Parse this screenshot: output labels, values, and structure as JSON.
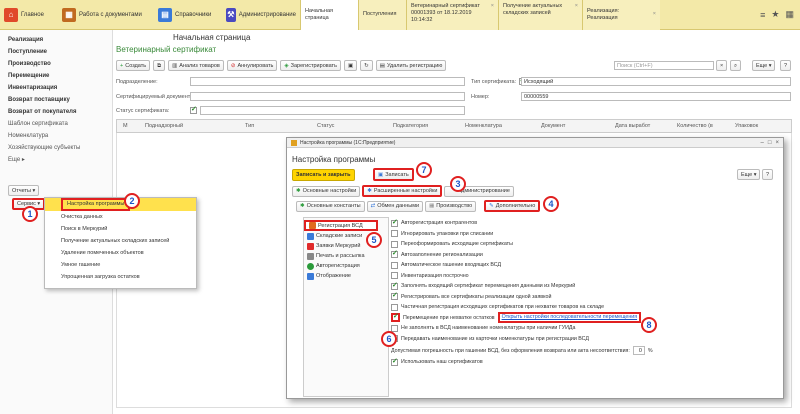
{
  "topbar": {
    "sections": [
      {
        "label": "Главное",
        "icon": "home-icon",
        "color": "#e04a2a"
      },
      {
        "label": "Работа с документами",
        "icon": "briefcase-icon",
        "color": "#c06a20"
      },
      {
        "label": "Справочники",
        "icon": "book-icon",
        "color": "#3a7ad8"
      },
      {
        "label": "Администрирование",
        "icon": "tools-icon",
        "color": "#4a4ac0"
      }
    ],
    "tabs": [
      "Начальная страница",
      "Поступления",
      "Ветеринарный сертификат 00001393 от 18.12.2019 10:14:32",
      "Получение актуальных складских записей",
      "Реализация: Реализация"
    ]
  },
  "leftnav": {
    "items": [
      "Реализация",
      "Поступление",
      "Производство",
      "Перемещение",
      "Инвентаризация",
      "Возврат поставщику",
      "Возврат от покупателя",
      "Шаблон сертификата",
      "Номенклатура",
      "Хозяйствующие субъекты",
      "Еще ▸"
    ],
    "reports": "Отчеты ▾",
    "service": "Сервис ▾"
  },
  "service_menu": [
    "Настройка программы",
    "Очистка данных",
    "Поиск в Меркурий",
    "Получение актуальных складских записей",
    "Удаление помеченных объектов",
    "Умное гашение",
    "Упрощенная загрузка остатков"
  ],
  "main": {
    "page_title": "Начальная страница",
    "doc_title": "Ветеринарный сертификат",
    "toolbar": [
      "Создать",
      "Анализ товаров",
      "Аннулировать",
      "Зарегистрировать",
      "Удалить регистрацию"
    ],
    "search_placeholder": "Поиск (Ctrl+F)",
    "more": "Еще ▾",
    "help": "?",
    "filters": {
      "subdivision": "Подразделение:",
      "certified_doc": "Сертифицируемый документ:",
      "status": "Статус сертификата:",
      "cert_type": "Тип сертификата:",
      "cert_type_value": "Исходящий",
      "number": "Номер:",
      "number_value": "00000559"
    },
    "columns": [
      "М",
      "Поднадзорный",
      "Тип",
      "Статус",
      "Подкатегория",
      "Номенклатура",
      "Документ",
      "Дата выработ",
      "Количество (в",
      "Упаковок"
    ]
  },
  "dialog": {
    "window_title": "Настройка программы (1С:Предприятие)",
    "title": "Настройка программы",
    "save_close": "Записать и закрыть",
    "save": "Записать",
    "more": "Еще ▾",
    "help": "?",
    "tabs1": [
      "Основные настройки",
      "Расширенные настройки",
      "Администрирование"
    ],
    "tabs2": [
      "Основные константы",
      "Обмен данными",
      "Производство",
      "Дополнительно"
    ],
    "sidebar": [
      {
        "label": "Регистрация ВСД",
        "color": "#e06a20"
      },
      {
        "label": "Складские записи",
        "color": "#3a7ad8"
      },
      {
        "label": "Заявки Меркурий",
        "color": "#e02a2a"
      },
      {
        "label": "Печать и рассылка",
        "color": "#888888"
      },
      {
        "label": "Авторегистрация",
        "color": "#2a9a3a"
      },
      {
        "label": "Отображение",
        "color": "#3a7ad8"
      }
    ],
    "options": [
      {
        "label": "Авторегистрация контрагентов",
        "on": true
      },
      {
        "label": "Игнорировать упаковки при списании",
        "on": false
      },
      {
        "label": "Переоформировать исходящие сертификаты",
        "on": false
      },
      {
        "label": "Автозаполнение регионализации",
        "on": true
      },
      {
        "label": "Автоматическое гашение входящих ВСД",
        "on": false
      },
      {
        "label": "Инвентаризация построчно",
        "on": false
      },
      {
        "label": "Заполнять входящий сертификат перемещения данными из Меркурий",
        "on": true
      },
      {
        "label": "Регистрировать все сертификаты реализации одной заявкой",
        "on": true
      },
      {
        "label": "Частичная регистрация исходящих сертификатов при нехватке товаров на складе",
        "on": false
      },
      {
        "label": "Перемещение при нехватке остатков",
        "on": true,
        "link": "Открыть настройки последовательности перемещения"
      },
      {
        "label": "Не заполнять в ВСД наименование номенклатуры при наличии ГУИДа",
        "on": false
      },
      {
        "label": "Передавать наименование из карточки номенклатуры при регистрации ВСД",
        "on": false
      }
    ],
    "tolerance_label": "Допустимая погрешность при гашении ВСД, без оформления возврата или акта несоответствия:",
    "tolerance_value": "0",
    "tolerance_unit": "%",
    "use_our_certs": "Использовать наш сертификатов",
    "use_our_certs_on": true
  },
  "callouts": [
    "1",
    "2",
    "3",
    "4",
    "5",
    "6",
    "7",
    "8"
  ]
}
